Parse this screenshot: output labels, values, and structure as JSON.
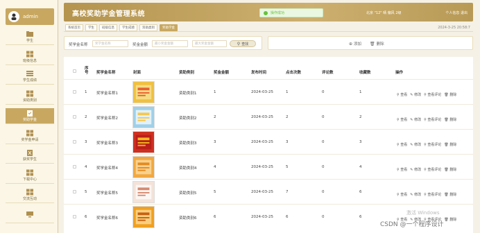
{
  "app": {
    "title": "高校奖助学金管理系统",
    "weather": "北京 \"12\"  晴  偏风 2级",
    "user_menu": "个人信息  退出",
    "toast": "操作成功",
    "datetime": "2024-3-25 20:58:7"
  },
  "sidebar": {
    "user": "admin",
    "items": [
      {
        "label": "学生",
        "icon": "folder-icon",
        "active": false
      },
      {
        "label": "班级信息",
        "icon": "grid-icon",
        "active": false
      },
      {
        "label": "学生成绩",
        "icon": "list-icon",
        "active": false
      },
      {
        "label": "资助类别",
        "icon": "grid-icon",
        "active": false
      },
      {
        "label": "奖助学金",
        "icon": "clipboard-check-icon",
        "active": true
      },
      {
        "label": "奖学金申请",
        "icon": "grid-icon",
        "active": false
      },
      {
        "label": "获奖学生",
        "icon": "clipboard-x-icon",
        "active": false
      },
      {
        "label": "下载中心",
        "icon": "grid-icon",
        "active": false
      },
      {
        "label": "交流互动",
        "icon": "grid-icon",
        "active": false
      },
      {
        "label": "",
        "icon": "monitor-icon",
        "active": false
      }
    ]
  },
  "breadcrumb": [
    "系统首页",
    "学生",
    "班级信息",
    "学生成绩",
    "资助类别",
    "奖助学金"
  ],
  "search": {
    "name_label": "奖学金名称",
    "name_placeholder": "奖学金名称",
    "amount_label": "奖金金额",
    "amount_min_placeholder": "最小奖金金额",
    "amount_max_placeholder": "最大奖金金额",
    "button": "查找"
  },
  "actions": {
    "add": "添加",
    "delete": "删除"
  },
  "table": {
    "headers": [
      "序号",
      "奖学金名称",
      "封面",
      "资助类别",
      "奖金金额",
      "发布时间",
      "点击次数",
      "评论数",
      "收藏数",
      "操作"
    ],
    "row_actions": [
      "查看",
      "修改",
      "查看评论",
      "删除"
    ],
    "rows": [
      {
        "idx": "1",
        "name": "奖学金名称1",
        "category": "资助类别1",
        "amount": "1",
        "date": "2024-03-25",
        "clicks": "1",
        "comments": "0",
        "favs": "1"
      },
      {
        "idx": "2",
        "name": "奖学金名称2",
        "category": "资助类别2",
        "amount": "2",
        "date": "2024-03-25",
        "clicks": "2",
        "comments": "0",
        "favs": "2"
      },
      {
        "idx": "3",
        "name": "奖学金名称3",
        "category": "资助类别3",
        "amount": "3",
        "date": "2024-03-25",
        "clicks": "3",
        "comments": "0",
        "favs": "3"
      },
      {
        "idx": "4",
        "name": "奖学金名称4",
        "category": "资助类别4",
        "amount": "4",
        "date": "2024-03-25",
        "clicks": "5",
        "comments": "0",
        "favs": "4"
      },
      {
        "idx": "5",
        "name": "奖学金名称5",
        "category": "资助类别5",
        "amount": "5",
        "date": "2024-03-25",
        "clicks": "7",
        "comments": "0",
        "favs": "6"
      },
      {
        "idx": "6",
        "name": "奖学金名称6",
        "category": "资助类别6",
        "amount": "6",
        "date": "2024-03-25",
        "clicks": "6",
        "comments": "0",
        "favs": "6"
      }
    ]
  },
  "watermark": {
    "activate": "激活 Windows",
    "credit": "CSDN @一个程序设计"
  }
}
